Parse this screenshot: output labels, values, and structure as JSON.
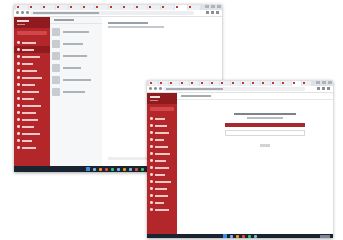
{
  "colors": {
    "desktop": "#1c63b5",
    "sidebar": "#b3262a",
    "sidebar_dark": "#8f1b1e",
    "accent_bar": "#a9282d",
    "taskbar": "#1a2330"
  },
  "screens": [
    {
      "browser_tab_count": 14,
      "sidebar_item_count": 16,
      "conversation_rows": 6
    },
    {
      "browser_tab_count": 16,
      "sidebar_item_count": 14,
      "form_fields": 1
    }
  ]
}
